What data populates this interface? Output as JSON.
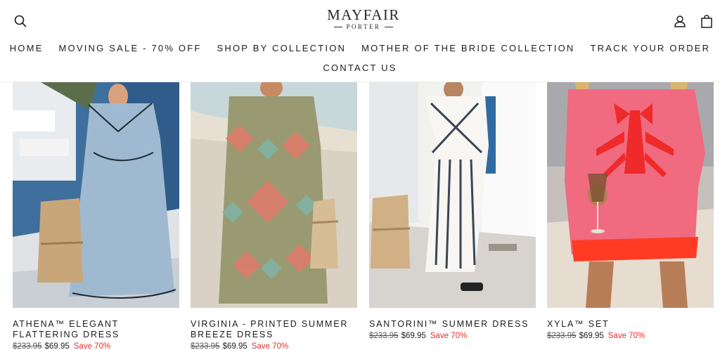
{
  "brand": {
    "name": "MAYFAIR",
    "sub": "PORTER"
  },
  "header": {
    "search_icon": "search-icon",
    "account_icon": "user-icon",
    "cart_icon": "shopping-bag-icon"
  },
  "nav": {
    "items": [
      "HOME",
      "MOVING SALE - 70% OFF",
      "SHOP BY COLLECTION",
      "MOTHER OF THE BRIDE COLLECTION",
      "TRACK YOUR ORDER",
      "CONTACT US"
    ]
  },
  "products": [
    {
      "title": "ATHENA™ ELEGANT FLATTERING DRESS",
      "old_price": "$233.95",
      "price": "$69.95",
      "badge": "Save 70%"
    },
    {
      "title": "VIRGINIA - PRINTED SUMMER BREEZE DRESS",
      "old_price": "$233.95",
      "price": "$69.95",
      "badge": "Save 70%"
    },
    {
      "title": "SANTORINI™ SUMMER DRESS",
      "old_price": "$233.95",
      "price": "$69.95",
      "badge": "Save 70%"
    },
    {
      "title": "XYLA™ SET",
      "old_price": "$233.95",
      "price": "$69.95",
      "badge": "Save 70%"
    }
  ],
  "colors": {
    "text": "#1c1d1d",
    "sale": "#e0312b",
    "background": "#ffffff"
  }
}
